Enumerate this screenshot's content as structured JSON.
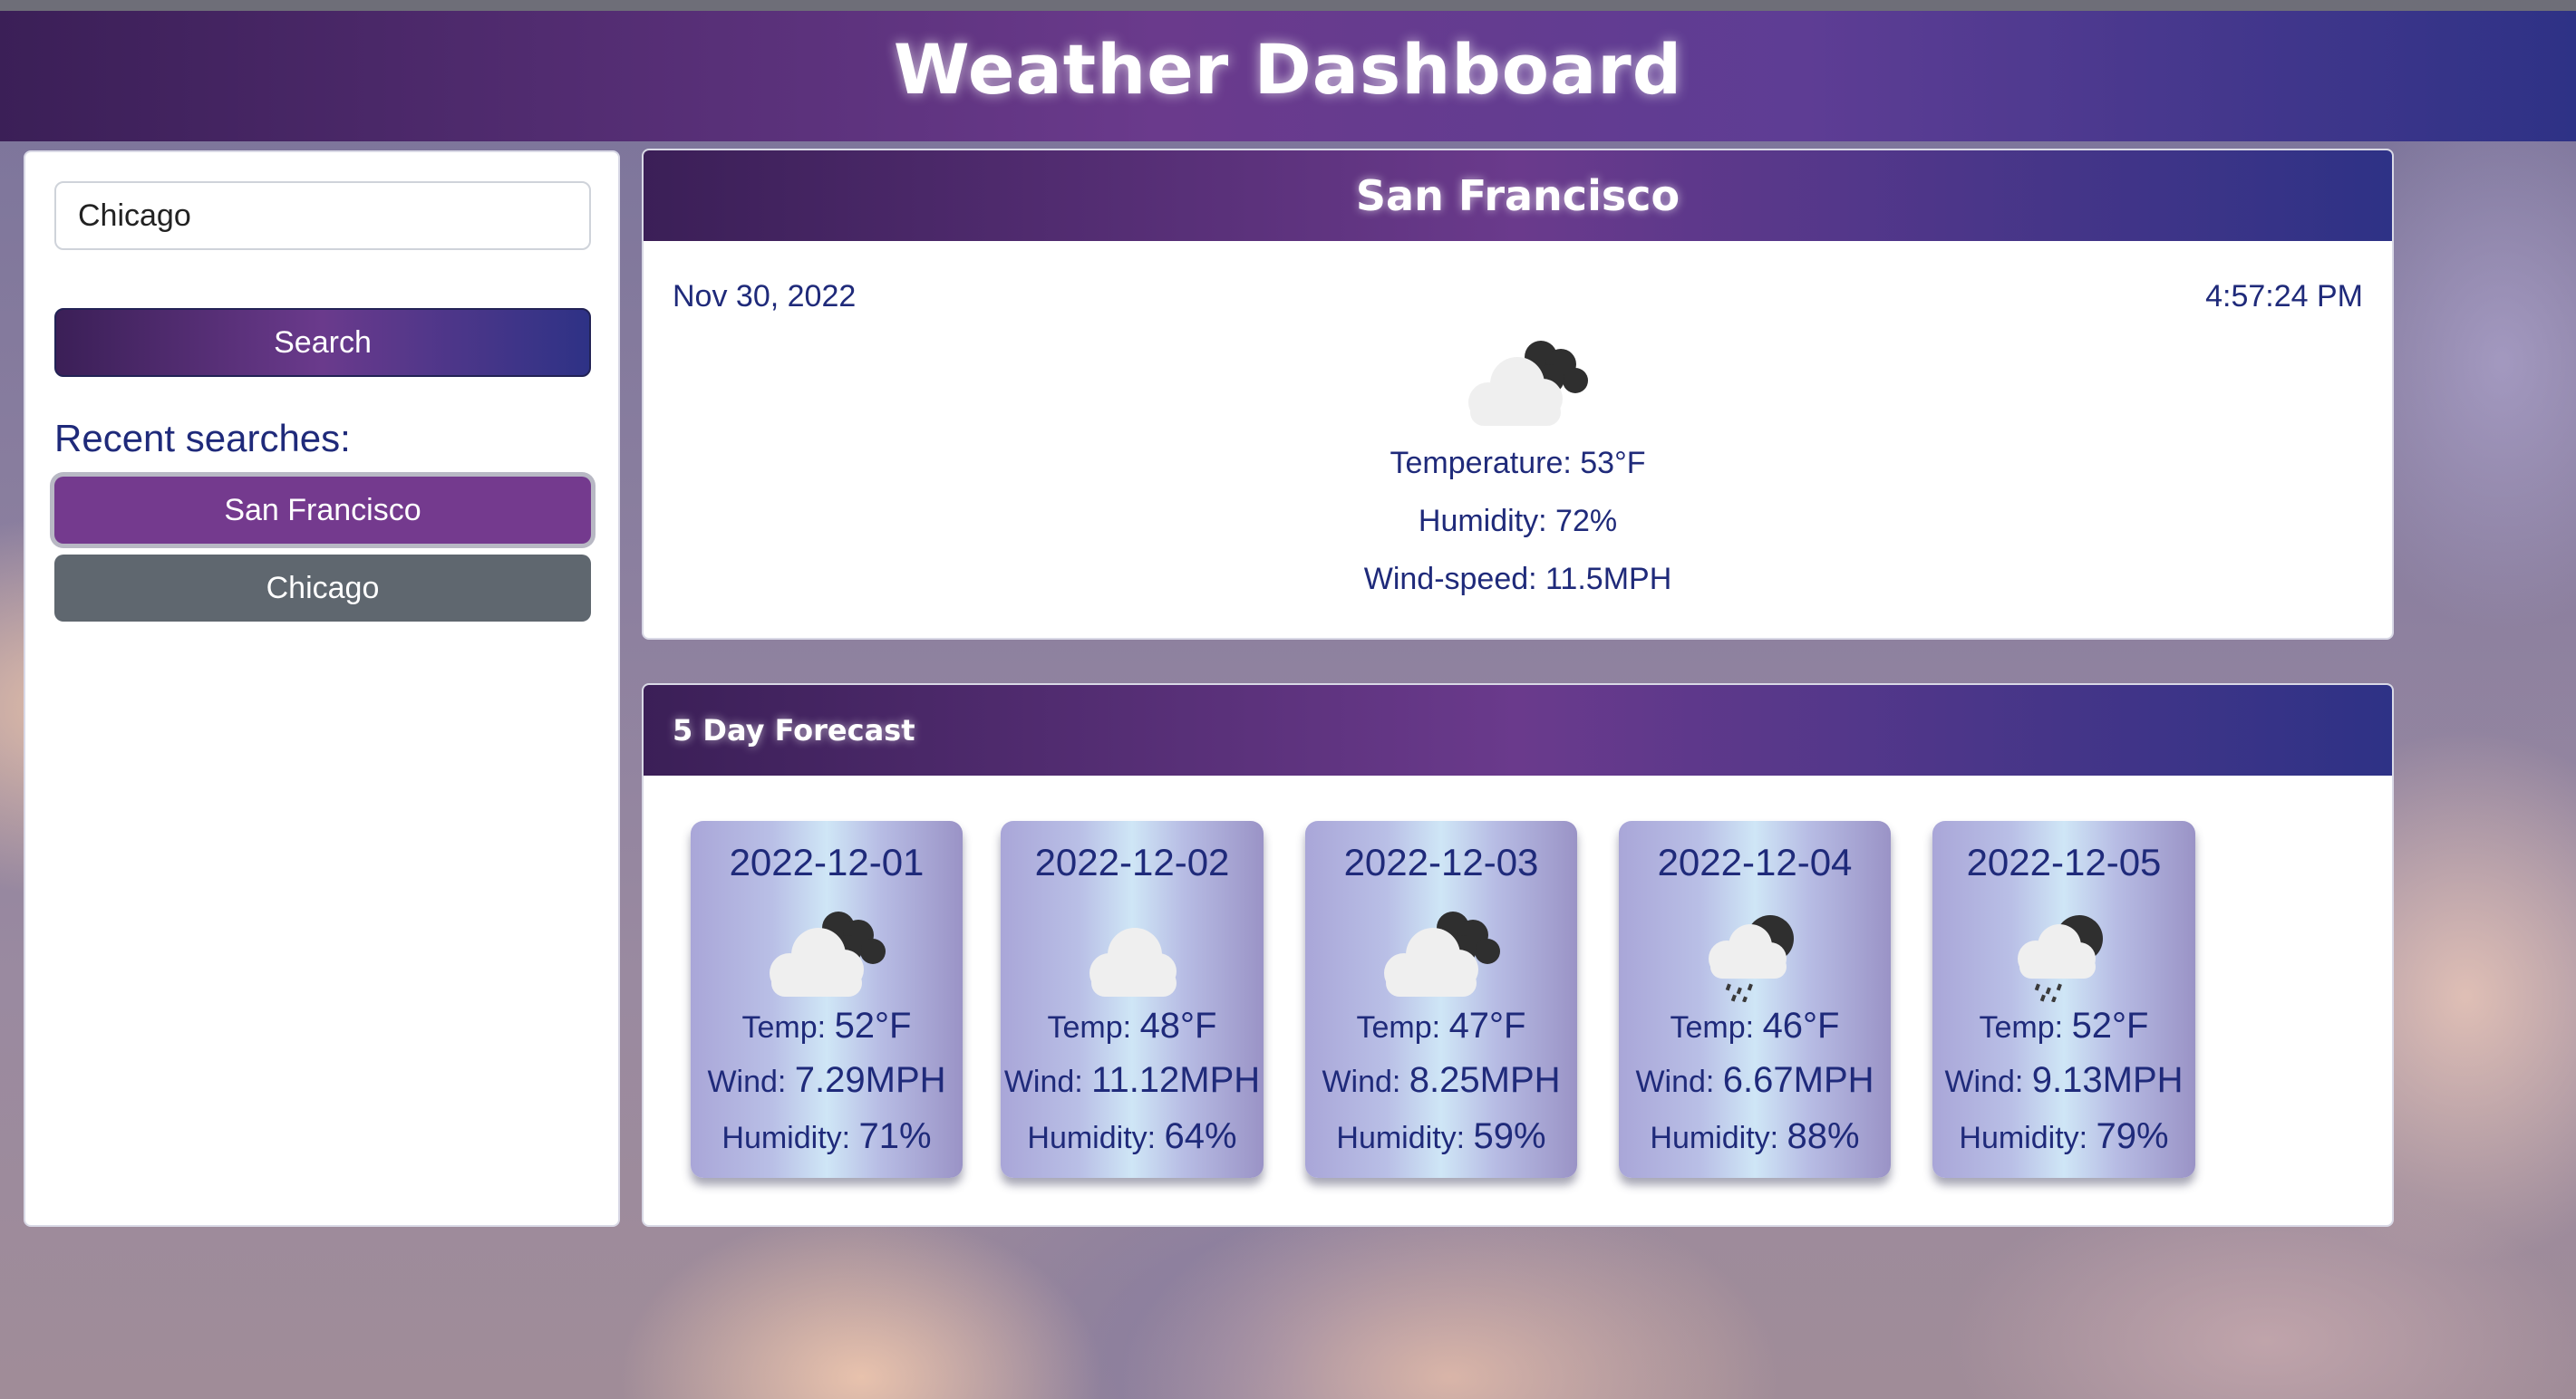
{
  "app": {
    "title": "Weather Dashboard"
  },
  "sidebar": {
    "search_value": "Chicago",
    "search_button": "Search",
    "recent_label": "Recent searches:",
    "recent": [
      "San Francisco",
      "Chicago"
    ]
  },
  "current": {
    "city": "San Francisco",
    "date": "Nov 30, 2022",
    "time": "4:57:24 PM",
    "icon": "cloud-night-icon",
    "temperature": "Temperature: 53°F",
    "humidity": "Humidity: 72%",
    "wind": "Wind-speed: 11.5MPH"
  },
  "forecast": {
    "title": "5 Day Forecast",
    "temp_label": "Temp: ",
    "wind_label": "Wind: ",
    "humidity_label": "Humidity: ",
    "days": [
      {
        "date": "2022-12-01",
        "icon": "cloud-night-icon",
        "temp": "52°F",
        "wind": "7.29MPH",
        "humidity": "71%"
      },
      {
        "date": "2022-12-02",
        "icon": "cloud-icon",
        "temp": "48°F",
        "wind": "11.12MPH",
        "humidity": "64%"
      },
      {
        "date": "2022-12-03",
        "icon": "cloud-night-icon",
        "temp": "47°F",
        "wind": "8.25MPH",
        "humidity": "59%"
      },
      {
        "date": "2022-12-04",
        "icon": "rain-night-icon",
        "temp": "46°F",
        "wind": "6.67MPH",
        "humidity": "88%"
      },
      {
        "date": "2022-12-05",
        "icon": "rain-night-icon",
        "temp": "52°F",
        "wind": "9.13MPH",
        "humidity": "79%"
      }
    ]
  },
  "colors": {
    "header_start": "#3b1f57",
    "header_mid": "#6a3a8c",
    "header_end": "#2e3286",
    "text_primary": "#1f2a7a",
    "active_recent": "#743a8e",
    "inactive_recent": "#5f676f"
  }
}
